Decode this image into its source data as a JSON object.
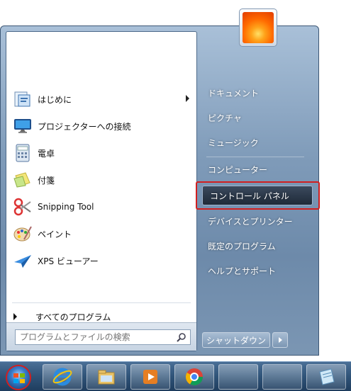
{
  "programs": [
    {
      "label": "はじめに",
      "icon": "getting-started-icon",
      "has_submenu": true
    },
    {
      "label": "プロジェクターへの接続",
      "icon": "projector-icon",
      "has_submenu": false
    },
    {
      "label": "電卓",
      "icon": "calculator-icon",
      "has_submenu": false
    },
    {
      "label": "付箋",
      "icon": "sticky-notes-icon",
      "has_submenu": false
    },
    {
      "label": "Snipping Tool",
      "icon": "scissors-icon",
      "has_submenu": false
    },
    {
      "label": "ペイント",
      "icon": "paint-palette-icon",
      "has_submenu": false
    },
    {
      "label": "XPS ビューアー",
      "icon": "xps-viewer-icon",
      "has_submenu": false
    }
  ],
  "all_programs": "すべてのプログラム",
  "search": {
    "placeholder": "プログラムとファイルの検索"
  },
  "right_pane": {
    "documents": "ドキュメント",
    "pictures": "ピクチャ",
    "music": "ミュージック",
    "computer": "コンピューター",
    "control_panel": "コントロール パネル",
    "devices": "デバイスとプリンター",
    "default_programs": "既定のプログラム",
    "help": "ヘルプとサポート"
  },
  "shutdown": {
    "label": "シャットダウン"
  },
  "taskbar": {
    "buttons": [
      "internet-explorer-icon",
      "file-explorer-icon",
      "media-player-icon",
      "chrome-icon",
      "empty-button",
      "empty-button",
      "notepad-icon"
    ]
  },
  "colors": {
    "highlight_outline": "#d21f1f"
  }
}
